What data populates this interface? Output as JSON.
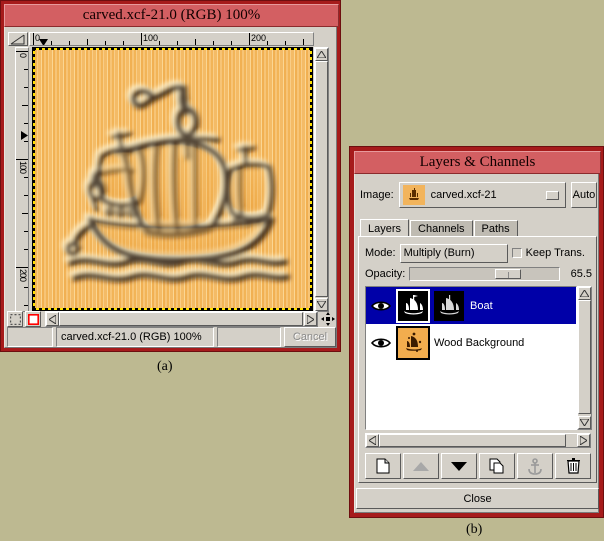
{
  "desktop": {
    "background_color": "#bdb991"
  },
  "image_window": {
    "title": "carved.xcf-21.0 (RGB) 100%",
    "titlebar_color": "#d35f62",
    "ruler": {
      "h_labels": [
        "0",
        "100",
        "200"
      ],
      "v_labels": [
        "0",
        "100",
        "200"
      ]
    },
    "canvas": {
      "content": "carved-wood-sailing-ship",
      "wood_light": "#f9cd87",
      "wood_mid": "#f7c476",
      "wood_dark": "#f1b052",
      "carve_shadow": "#2b1400",
      "carve_highlight": "#fff0c8"
    },
    "quickmask": {
      "off_label": "quickmask-off",
      "on_label": "quickmask-on"
    },
    "status": {
      "left": "",
      "center": "carved.xcf-21.0 (RGB) 100%",
      "right": "",
      "cancel_label": "Cancel"
    }
  },
  "layers_dialog": {
    "title": "Layers & Channels",
    "titlebar_color": "#d35f62",
    "image_label": "Image:",
    "image_name": "carved.xcf-21",
    "auto_label": "Auto",
    "tabs": [
      {
        "label": "Layers",
        "active": true
      },
      {
        "label": "Channels",
        "active": false
      },
      {
        "label": "Paths",
        "active": false
      }
    ],
    "mode_label": "Mode:",
    "mode_value": "Multiply (Burn)",
    "keep_trans_label": "Keep Trans.",
    "keep_trans_checked": false,
    "opacity_label": "Opacity:",
    "opacity_value": "65.5",
    "opacity_percent": 65.5,
    "layers": [
      {
        "name": "Boat",
        "visible": true,
        "selected": true,
        "has_mask": true,
        "thumb": "boat-on-black",
        "mask_thumb": "boat-mask"
      },
      {
        "name": "Wood Background",
        "visible": true,
        "selected": false,
        "has_mask": false,
        "thumb": "wood-texture"
      }
    ],
    "toolbar": [
      {
        "name": "new-layer",
        "label": "New Layer",
        "enabled": true
      },
      {
        "name": "raise-layer",
        "label": "Raise Layer",
        "enabled": false
      },
      {
        "name": "lower-layer",
        "label": "Lower Layer",
        "enabled": true
      },
      {
        "name": "duplicate-layer",
        "label": "Duplicate Layer",
        "enabled": true
      },
      {
        "name": "anchor-layer",
        "label": "Anchor Layer",
        "enabled": false
      },
      {
        "name": "delete-layer",
        "label": "Delete Layer",
        "enabled": true
      }
    ],
    "close_label": "Close"
  },
  "captions": {
    "a": "(a)",
    "b": "(b)"
  }
}
